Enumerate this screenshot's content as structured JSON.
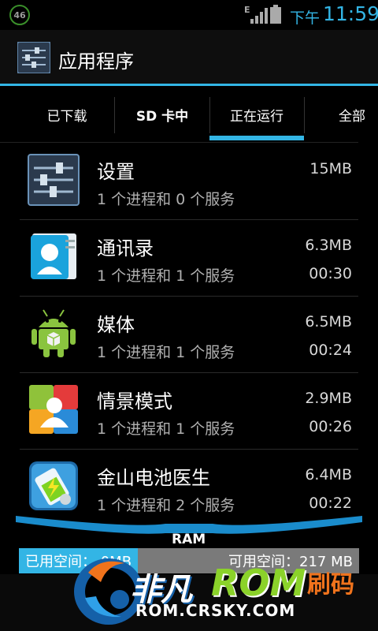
{
  "status_bar": {
    "badge": "46",
    "network": "E",
    "ampm": "下午",
    "time": "11:59",
    "accent_color": "#33b5e5"
  },
  "action_bar": {
    "title": "应用程序",
    "icon": "settings-sliders-icon"
  },
  "tabs": [
    {
      "label": "已下载",
      "selected": false
    },
    {
      "label": "SD 卡中",
      "selected": false
    },
    {
      "label": "正在运行",
      "selected": true
    },
    {
      "label": "全部",
      "selected": false
    }
  ],
  "apps": [
    {
      "name": "设置",
      "desc": "1 个进程和 0 个服务",
      "mem": "15MB",
      "time": "",
      "icon": "settings-icon"
    },
    {
      "name": "通讯录",
      "desc": "1 个进程和 1 个服务",
      "mem": "6.3MB",
      "time": "00:30",
      "icon": "contacts-icon"
    },
    {
      "name": "媒体",
      "desc": "1 个进程和 1 个服务",
      "mem": "6.5MB",
      "time": "00:24",
      "icon": "android-media-icon"
    },
    {
      "name": "情景模式",
      "desc": "1 个进程和 1 个服务",
      "mem": "2.9MB",
      "time": "00:26",
      "icon": "profiles-icon"
    },
    {
      "name": "金山电池医生",
      "desc": "1 个进程和 2 个服务",
      "mem": "6.4MB",
      "time": "00:22",
      "icon": "battery-doctor-icon"
    }
  ],
  "ram": {
    "label": "RAM",
    "used_text": "已用空间：  0MB",
    "free_text": "可用空间：217 MB",
    "used_fraction": 0.35
  },
  "watermark": {
    "cn": "非凡",
    "rom": "ROM",
    "extra": "刷码",
    "url": "ROM.CRSKY.COM"
  }
}
